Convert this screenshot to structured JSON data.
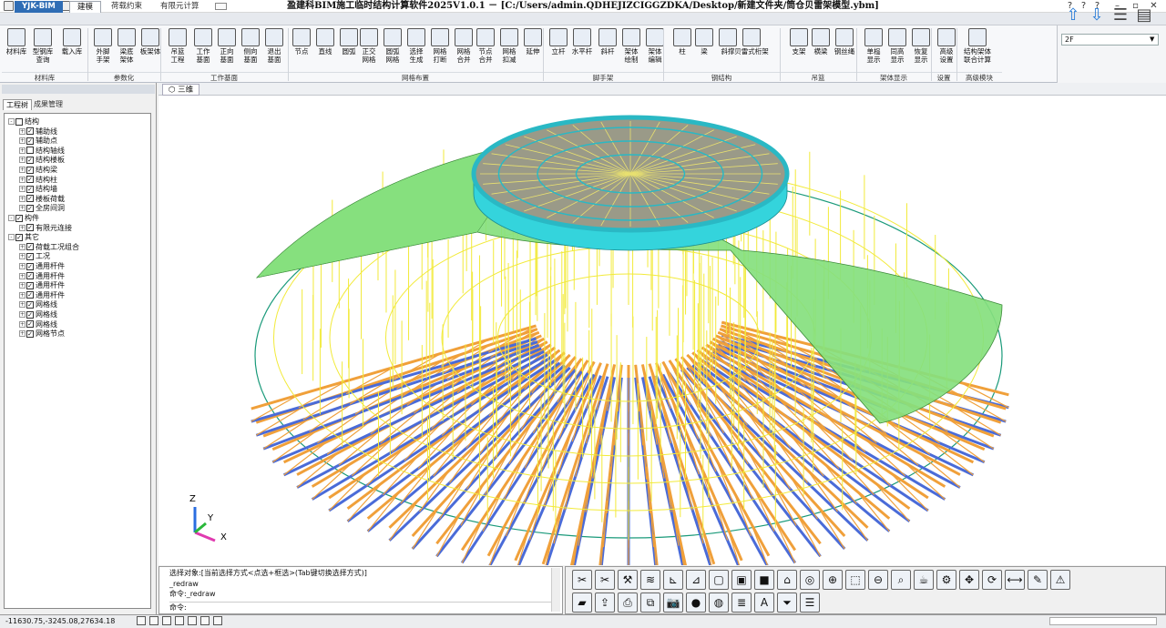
{
  "window": {
    "title": "盈建科BIM施工临时结构计算软件2025V1.0.1 － [C:/Users/admin.QDHEJIZCIGGZDKA/Desktop/新建文件夹/筒仓贝雷架模型.ybm]",
    "controls": [
      "?",
      "?",
      "?",
      "–",
      "▫",
      "✕"
    ]
  },
  "tabs": {
    "yjk": "YJK-BIM",
    "build": "建模",
    "load": "荷载约束",
    "fem": "有限元计算"
  },
  "ribbon": {
    "buttons": [
      {
        "label": "材料库",
        "icon": "material-library-icon"
      },
      {
        "label": "型钢库\n查询",
        "icon": "steel-library-icon"
      },
      {
        "label": "载入库",
        "icon": "load-library-icon"
      },
      {
        "label": "外脚\n手架",
        "icon": "scaffold-icon"
      },
      {
        "label": "梁底\n架体",
        "icon": "beam-support-icon"
      },
      {
        "label": "板架体",
        "icon": "slab-support-icon"
      },
      {
        "label": "吊篮\n工程",
        "icon": "hanging-basket-icon"
      },
      {
        "label": "工作\n基面",
        "icon": "work-plane-icon"
      },
      {
        "label": "正向\n基面",
        "icon": "front-plane-icon"
      },
      {
        "label": "侧向\n基面",
        "icon": "side-plane-icon"
      },
      {
        "label": "退出\n基面",
        "icon": "exit-plane-icon"
      },
      {
        "label": "节点",
        "icon": "node-icon"
      },
      {
        "label": "直线",
        "icon": "line-icon"
      },
      {
        "label": "圆弧",
        "icon": "arc-icon"
      },
      {
        "label": "正交\n网格",
        "icon": "ortho-grid-icon"
      },
      {
        "label": "圆弧\n网格",
        "icon": "arc-grid-icon"
      },
      {
        "label": "选择\n生成",
        "icon": "select-generate-icon"
      },
      {
        "label": "网格\n打断",
        "icon": "grid-break-icon"
      },
      {
        "label": "网格\n合并",
        "icon": "grid-merge-icon"
      },
      {
        "label": "节点\n合并",
        "icon": "node-merge-icon"
      },
      {
        "label": "网格\n扣减",
        "icon": "grid-subtract-icon"
      },
      {
        "label": "延伸",
        "icon": "extend-icon"
      },
      {
        "label": "立杆",
        "icon": "pole-icon"
      },
      {
        "label": "水平杆",
        "icon": "horizontal-bar-icon"
      },
      {
        "label": "斜杆",
        "icon": "diagonal-bar-icon"
      },
      {
        "label": "架体\n绘制",
        "icon": "frame-draw-icon"
      },
      {
        "label": "架体\n编辑",
        "icon": "frame-edit-icon"
      },
      {
        "label": "柱",
        "icon": "column-icon"
      },
      {
        "label": "梁",
        "icon": "beam-icon"
      },
      {
        "label": "斜撑",
        "icon": "brace-icon"
      },
      {
        "label": "贝雷式桁架",
        "icon": "bailey-truss-icon"
      },
      {
        "label": "支架",
        "icon": "support-icon"
      },
      {
        "label": "横梁",
        "icon": "crossbeam-icon"
      },
      {
        "label": "钢丝绳",
        "icon": "wire-rope-icon"
      },
      {
        "label": "单榀\n显示",
        "icon": "single-frame-icon"
      },
      {
        "label": "同高\n显示",
        "icon": "same-height-icon"
      },
      {
        "label": "恢复\n显示",
        "icon": "restore-display-icon"
      },
      {
        "label": "高级\n设置",
        "icon": "advanced-settings-icon"
      },
      {
        "label": "结构架体\n联合计算",
        "icon": "joint-calc-icon"
      }
    ],
    "groups": [
      "材料库",
      "参数化",
      "工作基面",
      "网格布置",
      "脚手架",
      "钢结构",
      "吊篮",
      "架体显示",
      "设置",
      "高级模块"
    ]
  },
  "floor": {
    "selected": "2F"
  },
  "left_panel": {
    "tabs": [
      "工程树",
      "成果管理"
    ],
    "tree": [
      {
        "label": "结构",
        "level": 0,
        "expand": "-",
        "checked": false
      },
      {
        "label": "辅助线",
        "level": 1,
        "expand": "+",
        "checked": true
      },
      {
        "label": "辅助点",
        "level": 1,
        "expand": "+",
        "checked": true
      },
      {
        "label": "结构轴线",
        "level": 1,
        "expand": "+",
        "checked": false
      },
      {
        "label": "结构楼板",
        "level": 1,
        "expand": "+",
        "checked": true
      },
      {
        "label": "结构梁",
        "level": 1,
        "expand": "+",
        "checked": true
      },
      {
        "label": "结构柱",
        "level": 1,
        "expand": "+",
        "checked": true
      },
      {
        "label": "结构墙",
        "level": 1,
        "expand": "+",
        "checked": true
      },
      {
        "label": "楼板荷载",
        "level": 1,
        "expand": "+",
        "checked": true
      },
      {
        "label": "全房间洞",
        "level": 1,
        "expand": "+",
        "checked": true
      },
      {
        "label": "构件",
        "level": 0,
        "expand": "-",
        "checked": true
      },
      {
        "label": "有限元连接",
        "level": 1,
        "expand": "+",
        "checked": true
      },
      {
        "label": "其它",
        "level": 0,
        "expand": "-",
        "checked": true
      },
      {
        "label": "荷载工况组合",
        "level": 1,
        "expand": "+",
        "checked": true
      },
      {
        "label": "工况",
        "level": 1,
        "expand": "+",
        "checked": true
      },
      {
        "label": "通用杆件",
        "level": 1,
        "expand": "+",
        "checked": true
      },
      {
        "label": "通用杆件",
        "level": 1,
        "expand": "+",
        "checked": true
      },
      {
        "label": "通用杆件",
        "level": 1,
        "expand": "+",
        "checked": true
      },
      {
        "label": "通用杆件",
        "level": 1,
        "expand": "+",
        "checked": true
      },
      {
        "label": "网格线",
        "level": 1,
        "expand": "+",
        "checked": true
      },
      {
        "label": "网格线",
        "level": 1,
        "expand": "+",
        "checked": true
      },
      {
        "label": "网格线",
        "level": 1,
        "expand": "+",
        "checked": true
      },
      {
        "label": "网格节点",
        "level": 1,
        "expand": "+",
        "checked": true
      }
    ]
  },
  "view": {
    "tab": "三维",
    "axes": {
      "z": "Z",
      "y": "Y",
      "x": "X"
    }
  },
  "command": {
    "lines": [
      "选择对象:[当前选择方式<点选+框选>(Tab键切换选择方式)]",
      "_redraw",
      "命令:_redraw"
    ],
    "prompt": "命令:"
  },
  "toolbar2_icons": [
    "cut-icon",
    "cut-all-icon",
    "tools-icon",
    "ruler-icon",
    "axis-icon",
    "distance-icon",
    "box-view-icon",
    "cube-view-icon",
    "solid-view-icon",
    "house-view-icon",
    "orbit-icon",
    "zoom-in-icon",
    "zoom-window-icon",
    "zoom-out-icon",
    "zoom-extent-icon",
    "teapot-icon",
    "wrench-icon",
    "pan-icon",
    "rotate-icon",
    "measure-icon",
    "pencil-icon",
    "warning-icon",
    "dwg-icon",
    "export-icon",
    "print-icon",
    "copy-icon",
    "camera-icon",
    "palette-icon",
    "sphere-icon",
    "layers-icon",
    "text-icon",
    "filter-icon",
    "list-icon"
  ],
  "status": {
    "coords": "-11630.75,-3245.08,27634.18"
  },
  "colors": {
    "scaffold_yellow": "#f2ea3a",
    "orange_bar": "#f0a03a",
    "blue_beam": "#4a6bd8",
    "green_roof": "#86e07e",
    "cyan_silo": "#34d4dc",
    "accent_blue": "#2f6db5"
  }
}
